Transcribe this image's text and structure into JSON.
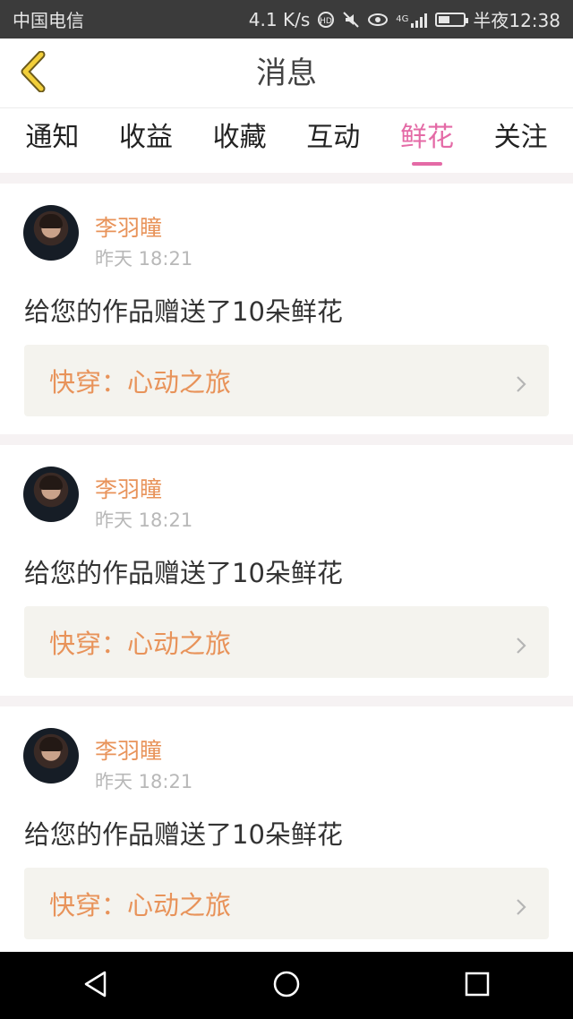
{
  "status_bar": {
    "carrier": "中国电信",
    "speed": "4.1 K/s",
    "network": "4G",
    "time": "半夜12:38",
    "battery_level": 0.45,
    "icons": [
      "hd-icon",
      "mute-icon",
      "eye-icon",
      "signal-icon",
      "battery-icon"
    ]
  },
  "header": {
    "title": "消息",
    "back_icon": "chevron-left-icon"
  },
  "tabs": [
    {
      "label": "通知",
      "active": false
    },
    {
      "label": "收益",
      "active": false
    },
    {
      "label": "收藏",
      "active": false
    },
    {
      "label": "互动",
      "active": false
    },
    {
      "label": "鲜花",
      "active": true
    },
    {
      "label": "关注",
      "active": false
    }
  ],
  "feed": [
    {
      "user": "李羽瞳",
      "time": "昨天 18:21",
      "message": "给您的作品赠送了10朵鲜花",
      "book": "快穿：心动之旅"
    },
    {
      "user": "李羽瞳",
      "time": "昨天 18:21",
      "message": "给您的作品赠送了10朵鲜花",
      "book": "快穿：心动之旅"
    },
    {
      "user": "李羽瞳",
      "time": "昨天 18:21",
      "message": "给您的作品赠送了10朵鲜花",
      "book": "快穿：心动之旅"
    }
  ],
  "colors": {
    "accent": "#e46aa6",
    "highlight": "#e8935a",
    "status_bar": "#3b3b3b",
    "link_bg": "#f4f3ee"
  },
  "navbar": {
    "icons": [
      "back-triangle-icon",
      "home-circle-icon",
      "recents-square-icon"
    ]
  }
}
